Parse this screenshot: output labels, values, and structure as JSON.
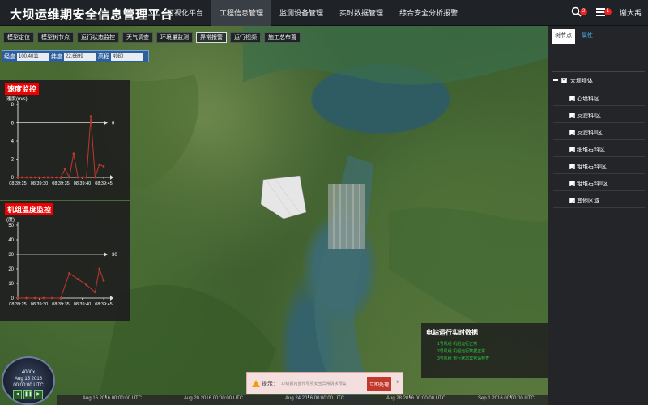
{
  "header": {
    "title": "大坝运维期安全信息管理平台",
    "nav": [
      "可视化平台",
      "工程信息管理",
      "监测设备管理",
      "实时数据管理",
      "综合安全分析报警"
    ],
    "active_nav": 1,
    "search_badge": "2",
    "message_badge": "1",
    "user": "谢大禹"
  },
  "toolbar": {
    "buttons": [
      "模型定位",
      "模型树节点",
      "运行状态监控",
      "天气调查",
      "环境量监测",
      "异常报警",
      "运行视频",
      "施工总布置"
    ],
    "active": 5
  },
  "coords": {
    "lon_label": "经度",
    "lon_value": "100.4011",
    "lat_label": "纬度",
    "lat_value": "22.6699",
    "elev_label": "高程",
    "elev_value": "4980"
  },
  "speed_chart": {
    "title": "速度监控",
    "ylabel": "速度(m/s)",
    "threshold_label": "6",
    "zero_label": "0"
  },
  "temp_chart": {
    "title": "机组温度监控",
    "ylabel": "(度)",
    "threshold_label": "30",
    "zero_label": "0"
  },
  "chart_data": [
    {
      "type": "line",
      "title": "速度监控",
      "ylabel": "速度(m/s)",
      "x_ticks": [
        "08:39:25",
        "08:39:30",
        "08:39:35",
        "08:39:40",
        "08:39:45"
      ],
      "y_ticks": [
        0,
        2,
        4,
        6,
        8
      ],
      "ylim": [
        0,
        8
      ],
      "xlim": [
        0,
        20
      ],
      "threshold": 6,
      "series": [
        {
          "x": [
            0,
            1,
            2,
            3,
            4,
            5,
            6,
            7,
            8,
            9,
            10,
            11,
            12,
            13,
            14,
            15,
            16,
            17,
            18,
            19,
            20
          ],
          "values": [
            0,
            0,
            0,
            0,
            0,
            0,
            0,
            0,
            0,
            0,
            0,
            0.9,
            0,
            2.6,
            0,
            0,
            0,
            6.7,
            0,
            1.4,
            1.2
          ]
        }
      ]
    },
    {
      "type": "line",
      "title": "机组温度监控",
      "ylabel": "(度)",
      "x_ticks": [
        "08:39:25",
        "08:39:30",
        "08:39:35",
        "08:39:40",
        "08:39:45"
      ],
      "y_ticks": [
        0,
        10,
        20,
        30,
        40,
        50
      ],
      "ylim": [
        0,
        50
      ],
      "xlim": [
        0,
        20
      ],
      "threshold": 30,
      "series": [
        {
          "x": [
            0,
            2,
            4,
            6,
            8,
            10,
            12,
            14,
            16,
            18,
            19,
            20
          ],
          "values": [
            0,
            0,
            0,
            0,
            0,
            0,
            17,
            13,
            9,
            4,
            20,
            12
          ]
        }
      ]
    }
  ],
  "right_panel": {
    "tabs": [
      "树节点",
      "属性"
    ],
    "active_tab": 0,
    "root": "大坝坝体",
    "items": [
      "心墙料区",
      "反滤料I区",
      "反滤料II区",
      "细堆石料区",
      "粗堆石料I区",
      "粗堆石料II区",
      "其他区域"
    ]
  },
  "station": {
    "title": "电站运行实时数据",
    "lines": [
      "1号机组 机组运行正常",
      "2号机组 机组运行数据正常",
      "3号机组 运行状态异常请检查"
    ]
  },
  "notify": {
    "label": "提示：",
    "message": "12级报内部传导坝安全异常请求预案",
    "button": "立即处理",
    "close": "×"
  },
  "clock": {
    "speed": "4000x",
    "date": "Aug 15 2016",
    "time": "00:00:00 UTC"
  },
  "timeline": [
    "Aug 16 2016 00:00:00 UTC",
    "Aug 20 2016 00:00:00 UTC",
    "Aug 24 2016 00:00:00 UTC",
    "Aug 28 2016 00:00:00 UTC",
    "Sep 1 2016 00:00:00 UTC"
  ],
  "colors": {
    "header_bg": "#1f2328",
    "alert_red": "#e00000",
    "series_line": "#c0392b",
    "coords_bg": "#2e5f9b",
    "station_text": "#2ecc40"
  }
}
